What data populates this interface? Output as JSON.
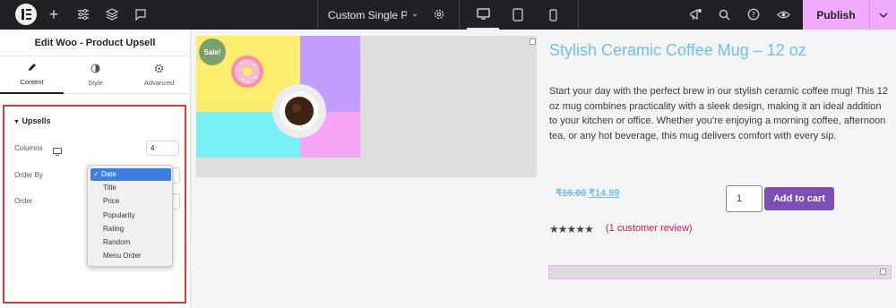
{
  "topbar": {
    "page_title": "Custom Single Pr…",
    "publish_label": "Publish"
  },
  "panel": {
    "title": "Edit Woo - Product Upsell",
    "tabs": [
      {
        "label": "Content",
        "icon": "pencil-icon"
      },
      {
        "label": "Style",
        "icon": "half-circle-icon"
      },
      {
        "label": "Advanced",
        "icon": "gear-icon"
      }
    ],
    "section": {
      "title": "Upsells",
      "columns_label": "Columns",
      "columns_value": "4",
      "order_by_label": "Order By",
      "order_label": "Order"
    },
    "order_by_options": [
      "Date",
      "Title",
      "Price",
      "Popularity",
      "Rating",
      "Random",
      "Menu Order"
    ],
    "order_by_selected": "Date",
    "selected_check": "✓"
  },
  "product": {
    "sale_badge": "Sale!",
    "title": "Stylish Ceramic Coffee Mug – 12 oz",
    "description": "Start your day with the perfect brew in our stylish ceramic coffee mug! This 12 oz mug combines practicality with a sleek design, making it an ideal addition to your kitchen or office. Whether you're enjoying a morning coffee, afternoon tea, or any hot beverage, this mug delivers comfort with every sip.",
    "old_price": "₹16.00",
    "new_price": "₹14.99",
    "quantity": "1",
    "add_to_cart": "Add to cart",
    "rating": 5,
    "review_text": "(1 customer review)"
  },
  "colors": {
    "publish_bg": "#f0abfc",
    "title_blue": "#6ec1e4",
    "cart_purple": "#7b4fb5",
    "highlight_red": "#e53935",
    "review_pink": "#c2185b"
  }
}
